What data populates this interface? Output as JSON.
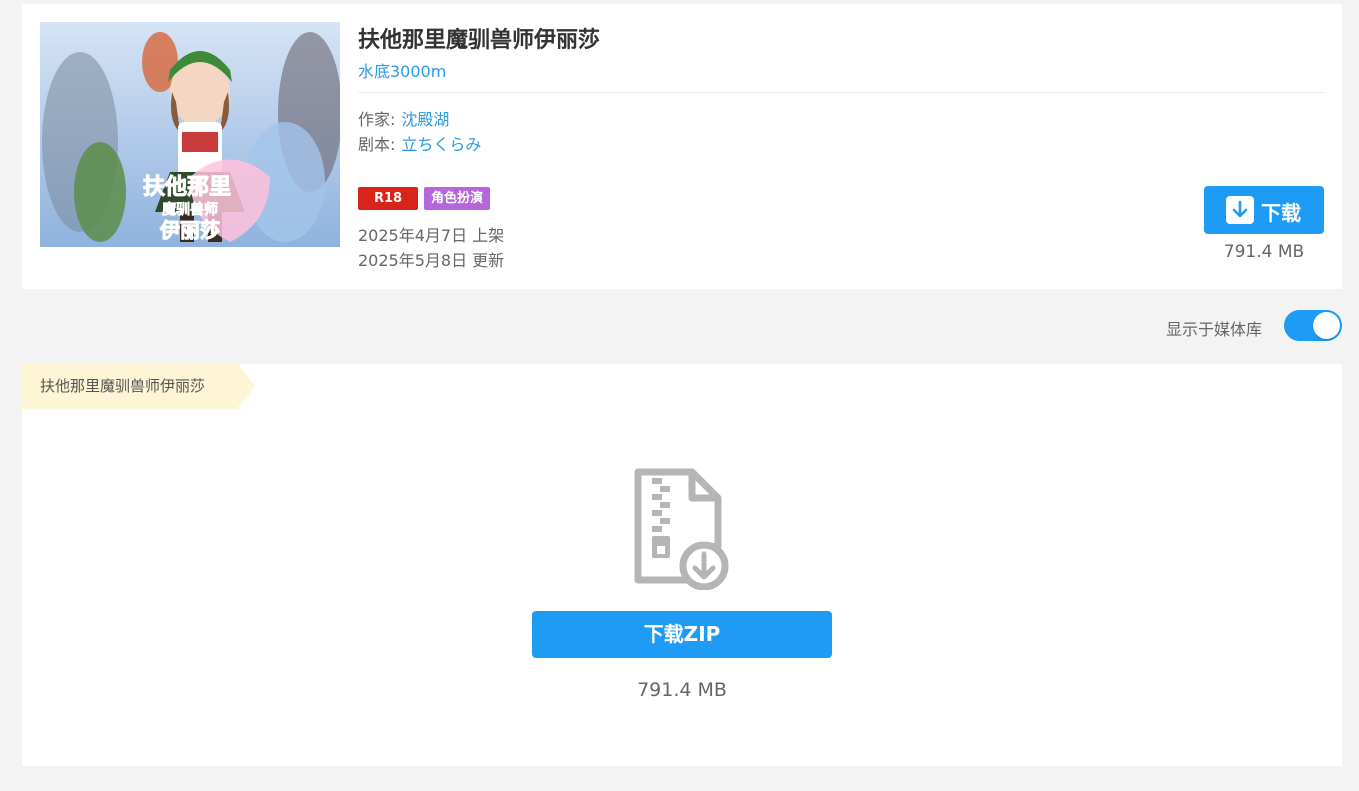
{
  "work": {
    "title": "扶他那里魔驯兽师伊丽莎",
    "circle": "水底3000m",
    "credits": {
      "author_key": "作家:",
      "author_value": "沈殿湖",
      "script_key": "剧本:",
      "script_value": "立ちくらみ"
    },
    "tags": [
      "R18",
      "角色扮演"
    ],
    "release_date": "2025年4月7日 上架",
    "update_date": "2025年5月8日 更新",
    "download_label": "下载",
    "size": "791.4 MB",
    "cover_title_lines": [
      "扶他那里",
      "魔驯兽师",
      "伊丽莎"
    ]
  },
  "library": {
    "label": "显示于媒体库",
    "enabled": true
  },
  "files": {
    "breadcrumb": "扶他那里魔驯兽师伊丽莎",
    "zip_button_label": "下载ZIP",
    "zip_size": "791.4 MB"
  },
  "colors": {
    "accent": "#1e9cf5",
    "link": "#2b9ae5",
    "tag_r18": "#d9241c",
    "tag_genre": "#b566db",
    "breadcrumb_bg": "#fdf5d5"
  }
}
